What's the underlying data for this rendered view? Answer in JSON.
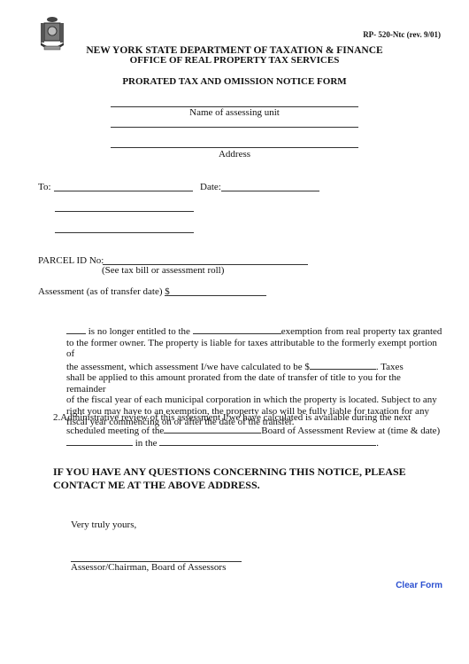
{
  "form_number": "RP- 520-Ntc (rev. 9/01)",
  "header": {
    "line1": "NEW YORK STATE DEPARTMENT OF TAXATION & FINANCE",
    "line2": "OFFICE OF REAL PROPERTY TAX SERVICES",
    "title": "PRORATED TAX AND OMISSION NOTICE FORM"
  },
  "assessing_unit_caption": "Name of assessing unit",
  "address_caption": "Address",
  "to_label": "To:",
  "date_label": "Date:",
  "parcel": {
    "label": "PARCEL ID No:",
    "hint": "(See tax bill or assessment roll)"
  },
  "assessment_label": "Assessment (as of transfer date) $",
  "paragraph1": {
    "seg1": "is no longer entitled to the",
    "seg2": "exemption from real property tax granted",
    "line2": "to the former owner.  The property is liable for taxes attributable to the formerly exempt portion of",
    "line3a": "the assessment, which assessment I/we have calculated to be $",
    "line3b": ".  Taxes",
    "line4": "shall be applied to this amount prorated from the date of transfer of title to you for the remainder",
    "line5": "of the fiscal year of each municipal corporation in which the property is located.  Subject to any",
    "line6": "right you may have to an exemption, the property also will be fully liable for taxation for any",
    "line7": "fiscal year commencing on or after the date of the transfer."
  },
  "paragraph2": {
    "line1": "2.Administrative review of this assessment I/we have calculated is available during the next",
    "line2a": "scheduled meeting of the",
    "line2b": "Board of Assessment Review at (time & date)",
    "line3": "in the",
    "line3_end": "."
  },
  "notice": "IF YOU HAVE ANY QUESTIONS CONCERNING THIS NOTICE, PLEASE CONTACT ME AT THE ABOVE ADDRESS.",
  "closing": "Very truly yours,",
  "signature_caption": "Assessor/Chairman, Board of Assessors",
  "clear_button": "Clear Form"
}
